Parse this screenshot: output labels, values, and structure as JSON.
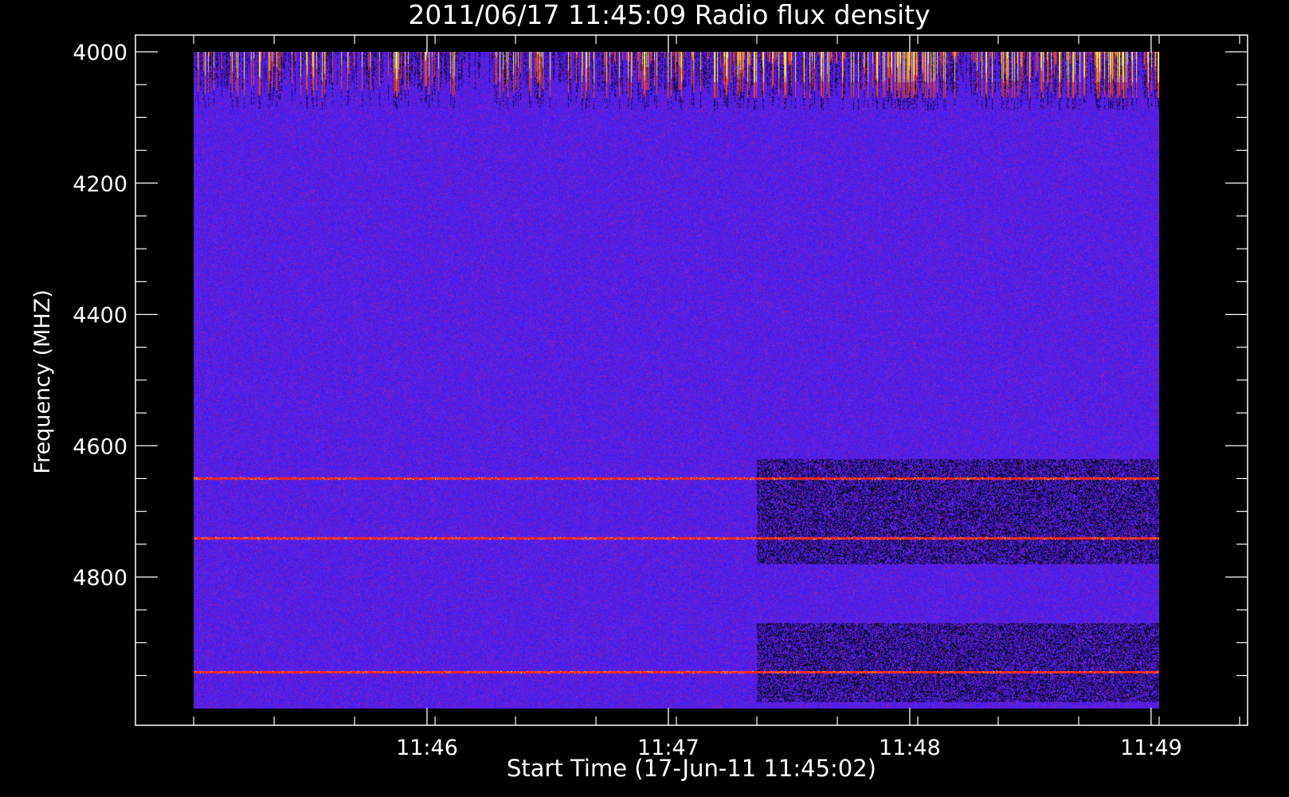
{
  "chart_data": {
    "type": "heatmap",
    "title": "2011/06/17 11:45:09 Radio flux density",
    "xlabel": "Start Time (17-Jun-11 11:45:02)",
    "ylabel": "Frequency (MHZ)",
    "x_unit": "seconds after 11:45:02",
    "xlim": [
      -60,
      300
    ],
    "ylim": [
      4000,
      5000
    ],
    "y_inverted": true,
    "x_ticks": [
      {
        "label": "11:46",
        "value": 58
      },
      {
        "label": "11:47",
        "value": 118
      },
      {
        "label": "11:48",
        "value": 178
      },
      {
        "label": "11:49",
        "value": 238
      }
    ],
    "y_ticks": [
      {
        "label": "4000",
        "value": 4000
      },
      {
        "label": "4200",
        "value": 4200
      },
      {
        "label": "4400",
        "value": 4400
      },
      {
        "label": "4600",
        "value": 4600
      },
      {
        "label": "4800",
        "value": 4800
      }
    ],
    "data_extent": {
      "x": [
        0,
        240
      ],
      "y": [
        4000,
        5000
      ]
    },
    "background_level": "blue",
    "features": [
      {
        "kind": "bursts",
        "y_range": [
          4000,
          4090
        ],
        "intensity": "high"
      },
      {
        "kind": "red-band",
        "y": 4650
      },
      {
        "kind": "red-band",
        "y": 4740
      },
      {
        "kind": "red-band",
        "y": 4945
      },
      {
        "kind": "dark-band",
        "y_range": [
          4620,
          4780
        ],
        "x_range": [
          140,
          240
        ]
      },
      {
        "kind": "dark-band",
        "y_range": [
          4870,
          4990
        ],
        "x_range": [
          140,
          240
        ]
      }
    ],
    "colors": {
      "background": "#000000",
      "axis": "#ffffff",
      "base": "#3a1ae0",
      "hot": "#ffe060",
      "warm": "#ff3a1a"
    },
    "grid": false,
    "legend": "none"
  }
}
